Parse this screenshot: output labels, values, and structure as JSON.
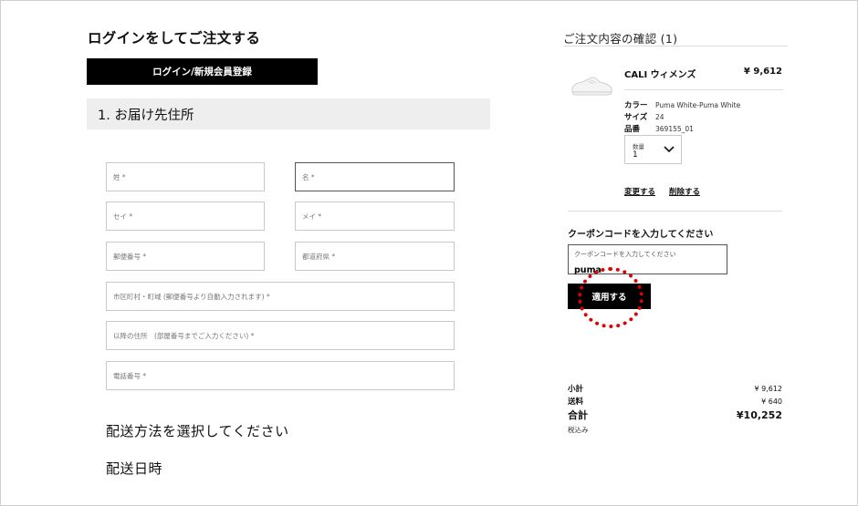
{
  "left": {
    "login_title": "ログインをしてご注文する",
    "login_button": "ログイン/新規会員登録",
    "section_title": "1. お届け先住所",
    "fields": {
      "last_name": "姓 *",
      "first_name": "名 *",
      "last_name_kana": "セイ *",
      "first_name_kana": "メイ *",
      "postal_code": "郵便番号 *",
      "prefecture": "都道府県 *",
      "city": "市区町村・町域 (郵便番号より自動入力されます) *",
      "address_rest": "以降の住所　(部屋番号までご入力ください) *",
      "phone": "電話番号 *"
    },
    "shipping_method_title": "配送方法を選択してください",
    "delivery_date_title": "配送日時"
  },
  "order": {
    "title": "ご注文内容の確認 (1)",
    "product": {
      "image_icon": "sneaker-icon",
      "name": "CALI ウィメンズ",
      "price": "¥ 9,612",
      "specs": [
        {
          "key": "カラー",
          "value": "Puma White-Puma White"
        },
        {
          "key": "サイズ",
          "value": "24"
        },
        {
          "key": "品番",
          "value": "369155_01"
        }
      ],
      "qty_label": "数量",
      "qty_value": "1",
      "change_link": "変更する",
      "delete_link": "削除する"
    },
    "coupon": {
      "title": "クーポンコードを入力してください",
      "placeholder": "クーポンコードを入力してください",
      "value": "puma",
      "apply_button": "適用する",
      "highlight_color": "#e00000"
    },
    "summary": {
      "subtotal_label": "小計",
      "subtotal_value": "¥ 9,612",
      "shipping_label": "送料",
      "shipping_value": "¥ 640",
      "total_label": "合計",
      "total_value": "¥10,252",
      "tax_note": "税込み"
    }
  }
}
